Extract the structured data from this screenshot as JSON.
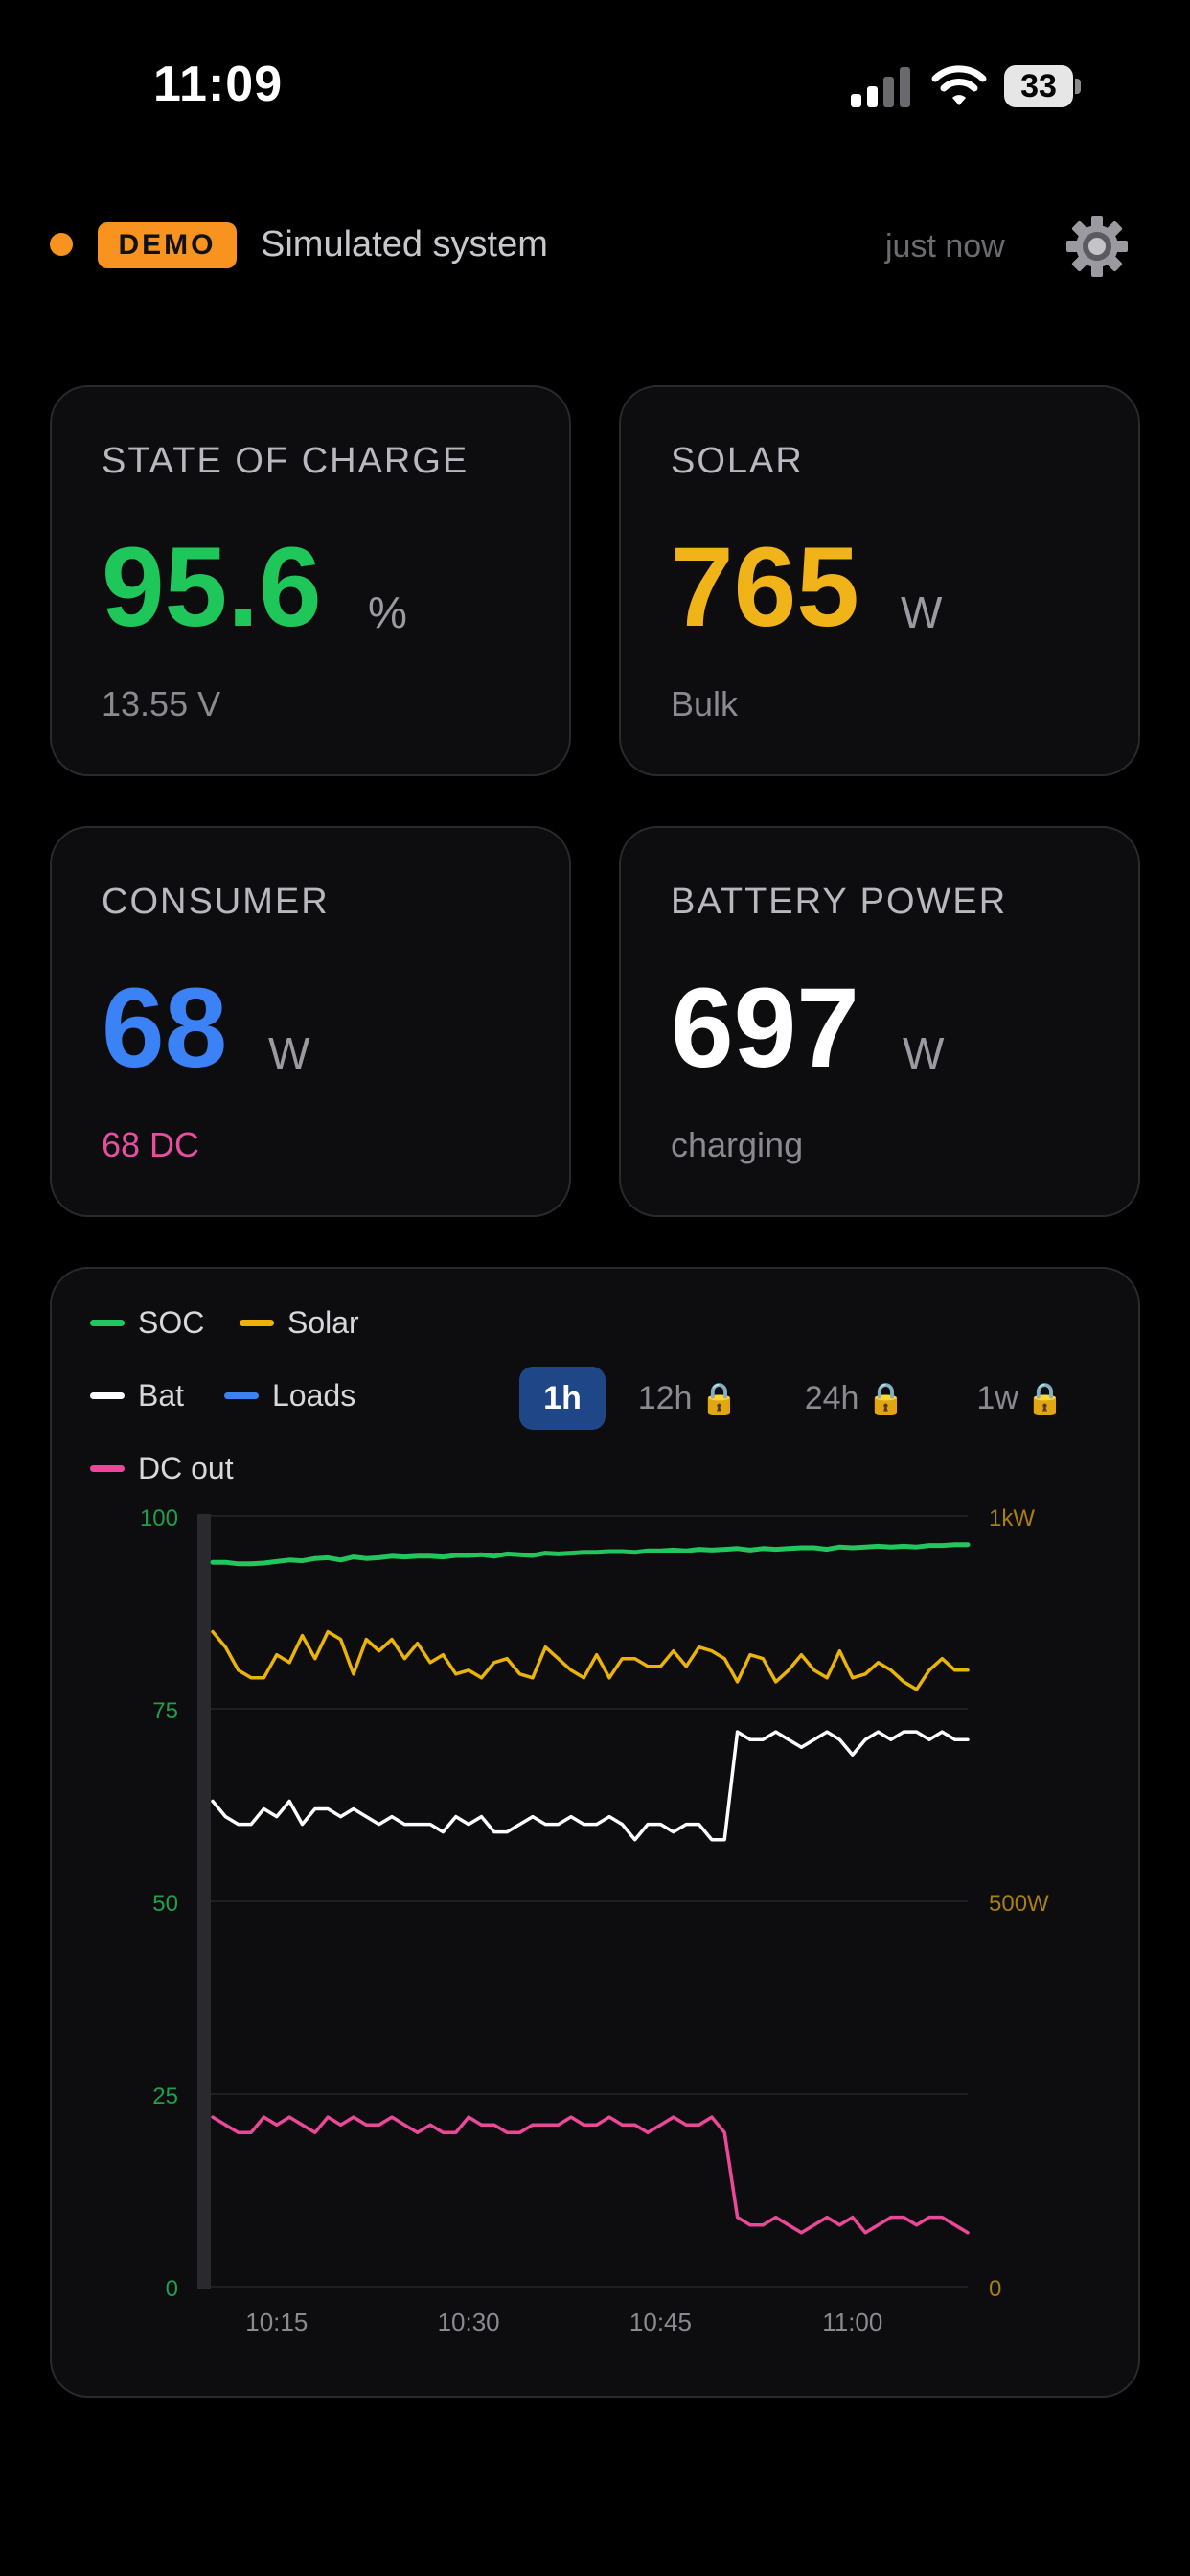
{
  "status_bar": {
    "time": "11:09",
    "battery": "33"
  },
  "header": {
    "badge": "DEMO",
    "label": "Simulated system",
    "updated": "just now"
  },
  "cards": {
    "soc": {
      "title": "STATE OF CHARGE",
      "value": "95.6",
      "unit": "%",
      "sub": "13.55 V",
      "color": "#1fc65a"
    },
    "solar": {
      "title": "SOLAR",
      "value": "765",
      "unit": "W",
      "sub": "Bulk",
      "color": "#f0b418"
    },
    "consumer": {
      "title": "CONSUMER",
      "value": "68",
      "unit": "W",
      "sub": "68 DC",
      "color": "#3b82f6",
      "sub_color": "#e64fa0"
    },
    "battery": {
      "title": "BATTERY POWER",
      "value": "697",
      "unit": "W",
      "sub": "charging",
      "color": "#ffffff"
    }
  },
  "legend": [
    {
      "name": "SOC",
      "color": "#22c55e"
    },
    {
      "name": "Solar",
      "color": "#eab308"
    },
    {
      "name": "Bat",
      "color": "#ffffff"
    },
    {
      "name": "Loads",
      "color": "#3b82f6"
    },
    {
      "name": "DC out",
      "color": "#ec4899"
    }
  ],
  "ranges": [
    {
      "label": "1h",
      "active": true,
      "locked": false
    },
    {
      "label": "12h",
      "active": false,
      "locked": true
    },
    {
      "label": "24h",
      "active": false,
      "locked": true
    },
    {
      "label": "1w",
      "active": false,
      "locked": true
    }
  ],
  "icons": {
    "settings": "gear-icon",
    "lock": "lock-icon",
    "signal": "cellular-signal-icon",
    "wifi": "wifi-icon",
    "battery": "battery-icon"
  },
  "chart_data": {
    "type": "line",
    "x_ticks": [
      "10:15",
      "10:30",
      "10:45",
      "11:00"
    ],
    "y_left": {
      "ticks": [
        "100",
        "75",
        "50",
        "25",
        "0"
      ],
      "range": [
        0,
        100
      ]
    },
    "y_right": {
      "ticks": [
        "1kW",
        "500W",
        "0"
      ],
      "range": [
        0,
        1000
      ]
    },
    "grid": true,
    "x_start_minute": 10,
    "x_end_minute": 69,
    "series": [
      {
        "name": "SOC",
        "axis": "left",
        "color": "#22c55e",
        "values": [
          94.0,
          94.0,
          93.8,
          93.8,
          93.9,
          94.1,
          94.3,
          94.2,
          94.5,
          94.6,
          94.3,
          94.7,
          94.5,
          94.6,
          94.8,
          94.7,
          94.8,
          94.8,
          94.7,
          94.9,
          94.9,
          95.0,
          94.8,
          95.1,
          95.0,
          94.9,
          95.2,
          95.1,
          95.2,
          95.3,
          95.3,
          95.4,
          95.4,
          95.3,
          95.5,
          95.5,
          95.6,
          95.5,
          95.7,
          95.6,
          95.7,
          95.8,
          95.6,
          95.8,
          95.7,
          95.8,
          95.9,
          95.9,
          95.7,
          96.0,
          95.9,
          96.0,
          96.1,
          96.0,
          96.1,
          96.0,
          96.2,
          96.2,
          96.3,
          96.3
        ]
      },
      {
        "name": "Solar",
        "axis": "right",
        "color": "#eab308",
        "values": [
          850,
          830,
          800,
          790,
          790,
          820,
          810,
          845,
          815,
          850,
          840,
          795,
          840,
          825,
          840,
          815,
          835,
          810,
          820,
          795,
          800,
          790,
          810,
          815,
          795,
          790,
          830,
          815,
          800,
          790,
          820,
          790,
          815,
          815,
          805,
          805,
          825,
          805,
          830,
          825,
          815,
          785,
          820,
          815,
          785,
          800,
          820,
          800,
          790,
          825,
          790,
          795,
          810,
          800,
          785,
          775,
          800,
          815,
          800,
          800
        ]
      },
      {
        "name": "Bat",
        "axis": "left",
        "color": "#ffffff",
        "values": [
          63,
          61,
          60,
          60,
          62,
          61,
          63,
          60,
          62,
          62,
          61,
          62,
          61,
          60,
          61,
          60,
          60,
          60,
          59,
          61,
          60,
          61,
          59,
          59,
          60,
          61,
          60,
          60,
          61,
          60,
          60,
          61,
          60,
          58,
          60,
          60,
          59,
          60,
          60,
          58,
          58,
          72,
          71,
          71,
          72,
          71,
          70,
          71,
          72,
          71,
          69,
          71,
          72,
          71,
          72,
          72,
          71,
          72,
          71,
          71
        ]
      },
      {
        "name": "DC out",
        "axis": "left",
        "color": "#ec4899",
        "values": [
          22,
          21,
          20,
          20,
          22,
          21,
          22,
          21,
          20,
          22,
          21,
          22,
          21,
          21,
          22,
          21,
          20,
          21,
          20,
          20,
          22,
          21,
          21,
          20,
          20,
          21,
          21,
          21,
          22,
          21,
          21,
          22,
          21,
          21,
          20,
          21,
          22,
          21,
          21,
          22,
          20,
          9,
          8,
          8,
          9,
          8,
          7,
          8,
          9,
          8,
          9,
          7,
          8,
          9,
          9,
          8,
          9,
          9,
          8,
          7
        ]
      }
    ]
  }
}
